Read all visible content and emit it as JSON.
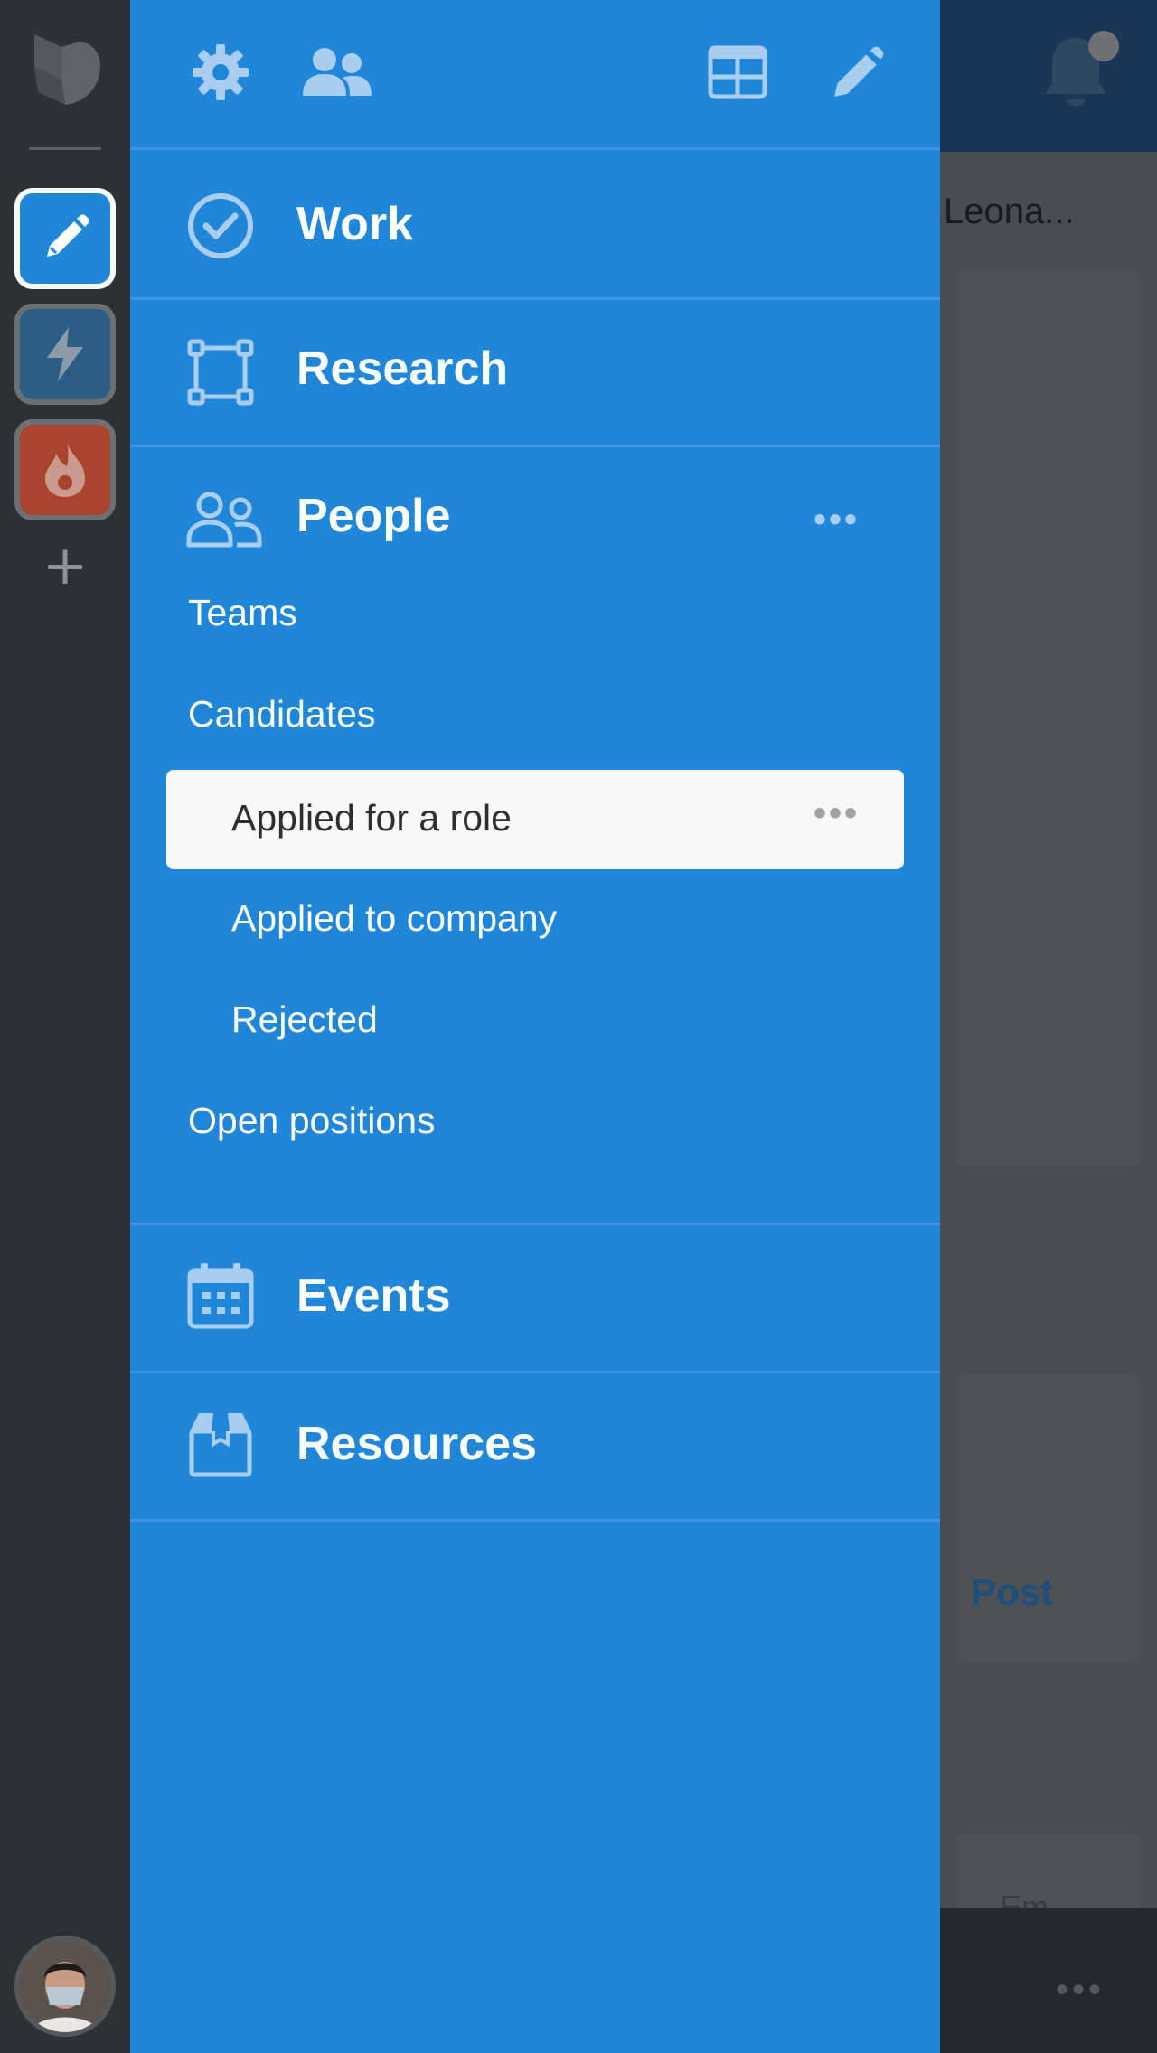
{
  "drawer": {
    "sections": {
      "work": "Work",
      "research": "Research",
      "people": "People",
      "events": "Events",
      "resources": "Resources"
    },
    "people_items": {
      "teams": "Teams",
      "candidates": "Candidates",
      "applied_role": "Applied for a role",
      "applied_company": "Applied to company",
      "rejected": "Rejected",
      "open_positions": "Open positions"
    },
    "more_glyph": "•••"
  },
  "background": {
    "item_title": "Leona...",
    "post_label": "Post",
    "partial_label": "Em",
    "more_glyph": "•••"
  },
  "rail": {
    "add_glyph": "+"
  },
  "colors": {
    "drawer_bg": "#1f86d9",
    "rail_bg": "#2e3134",
    "selected_bg": "#f7f8f7",
    "icon_tint": "#a9cdef"
  },
  "icons": {
    "rail": [
      "app-logo-icon",
      "pencil-icon",
      "bolt-icon",
      "flame-icon",
      "plus-icon"
    ],
    "topbar": [
      "gear-icon",
      "people-icon",
      "grid-icon",
      "pencil-icon"
    ],
    "sections": [
      "check-circle-icon",
      "frame-icon",
      "people-icon",
      "calendar-icon",
      "box-icon"
    ]
  }
}
